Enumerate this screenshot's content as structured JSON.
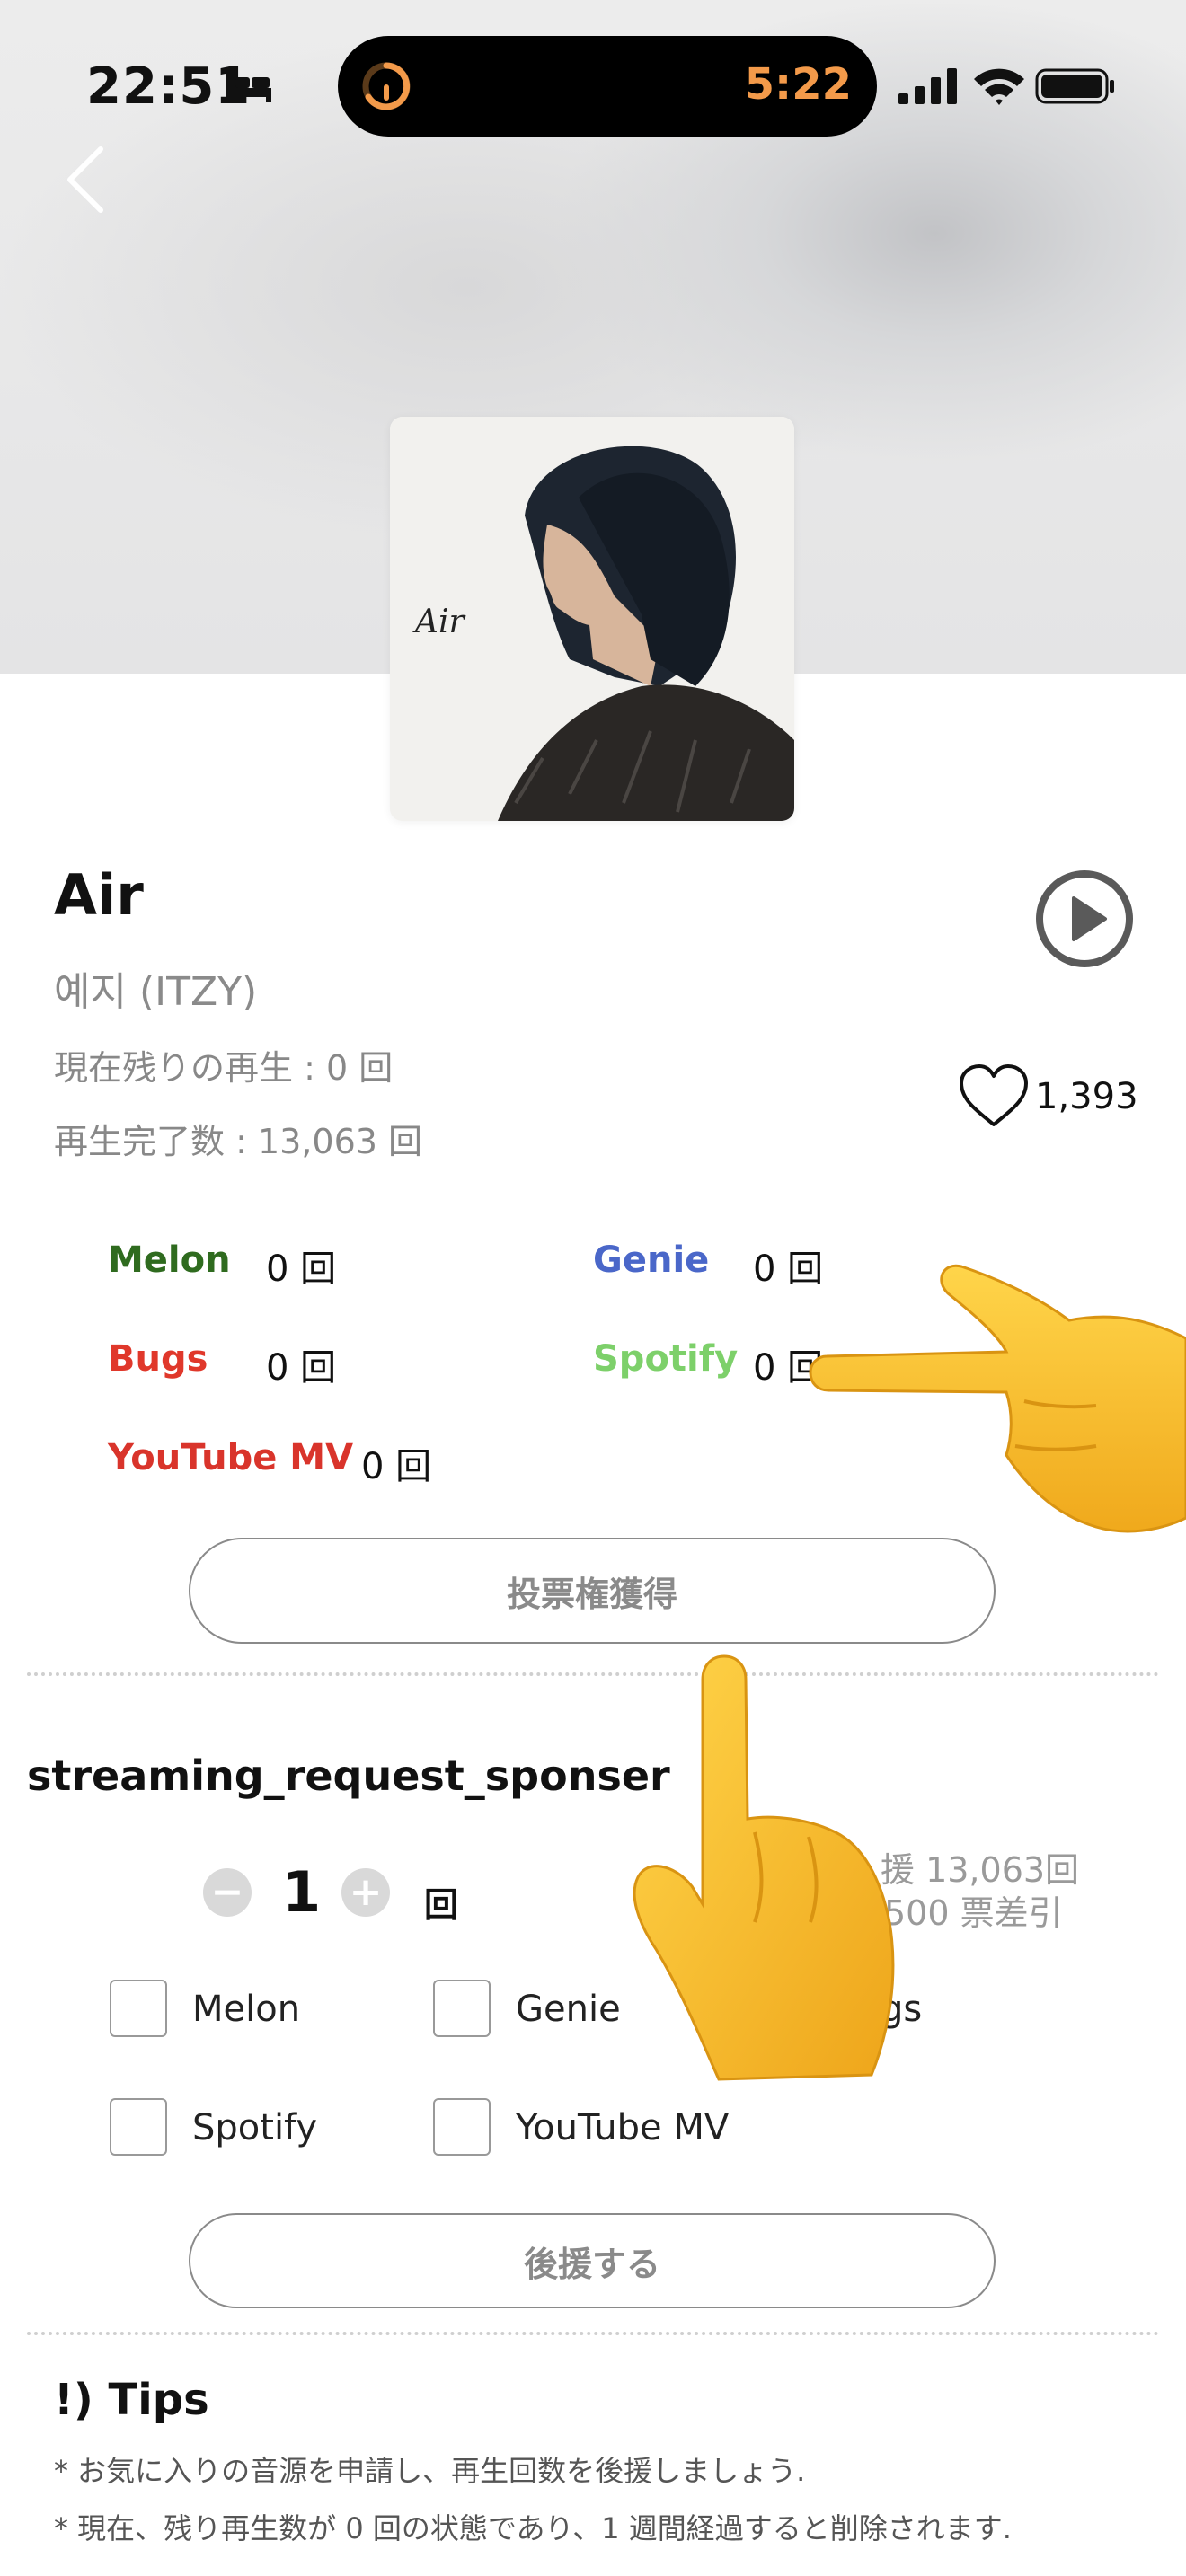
{
  "status_bar": {
    "time": "22:51",
    "island_timer": "5:22"
  },
  "song": {
    "title": "Air",
    "artist": "예지 (ITZY)",
    "remaining": "現在残りの再生 : 0 回",
    "completed": "再生完了数 : 13,063 回",
    "likes": "1,393",
    "cover_text": "Air"
  },
  "platforms": [
    {
      "name": "Melon",
      "count": "0 回",
      "color": "#2f6b1f"
    },
    {
      "name": "Genie",
      "count": "0 回",
      "color": "#4a67c9"
    },
    {
      "name": "Bugs",
      "count": "0 回",
      "color": "#e0382b"
    },
    {
      "name": "Spotify",
      "count": "0 回",
      "color": "#7dd06a"
    },
    {
      "name": "YouTube MV",
      "count": "0 回",
      "color": "#d9342b"
    }
  ],
  "vote_button": "投票権獲得",
  "sponsor": {
    "title": "streaming_request_sponser",
    "quantity": "1",
    "unit": "回",
    "minus": "−",
    "plus": "+",
    "info_line1": "援 13,063回",
    "info_line2": "500 票差引",
    "checkboxes": [
      "Melon",
      "Genie",
      "gs",
      "Spotify",
      "YouTube MV"
    ],
    "button": "後援する"
  },
  "tips": {
    "title": "!) Tips",
    "lines": [
      "* お気に入りの音源を申請し、再生回数を後援しましょう.",
      "* 現在、残り再生数が 0 回の状態であり、1 週間経過すると削除されます."
    ]
  }
}
